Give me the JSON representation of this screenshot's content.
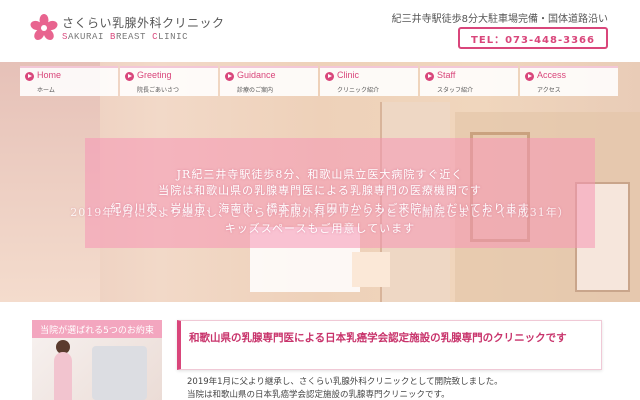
{
  "header": {
    "logo_jp": "さくらい乳腺外科クリニック",
    "logo_en_parts": [
      "S",
      "AKURAI ",
      "B",
      "REAST ",
      "C",
      "LINIC"
    ],
    "access_note": "紀三井寺駅徒歩8分大駐車場完備・国体道路沿い",
    "tel": "TEL：073-448-3366"
  },
  "nav": [
    {
      "en": "Home",
      "jp": "ホーム"
    },
    {
      "en": "Greeting",
      "jp": "院長ごあいさつ"
    },
    {
      "en": "Guidance",
      "jp": "診療のご案内"
    },
    {
      "en": "Clinic",
      "jp": "クリニック紹介"
    },
    {
      "en": "Staff",
      "jp": "スタッフ紹介"
    },
    {
      "en": "Access",
      "jp": "アクセス"
    }
  ],
  "hero": {
    "line1": "JR紀三井寺駅徒歩8分、和歌山県立医大病院すぐ近く",
    "line2": "当院は和歌山県の乳腺専門医による乳腺専門の医療機関です",
    "line3": "紀の川市、岩出市、海南市、橋本市、有田市からもご来院いただいております",
    "line4": "2019年1月に父より継承し、さくらい乳腺外科クリニックとして開院しました（平成31年）",
    "line5": "キッズスペースもご用意しています"
  },
  "promise": {
    "title": "当院が選ばれる5つのお約束"
  },
  "main": {
    "heading": "和歌山県の乳腺専門医による日本乳癌学会認定施設の乳腺専門のクリニックです",
    "body_line1": "2019年1月に父より継承し、さくらい乳腺外科クリニックとして開院致しました。",
    "body_line2": "当院は和歌山県の日本乳癌学会認定施設の乳腺専門クリニックです。"
  },
  "colors": {
    "brand_pink": "#d9467b",
    "hero_band": "#f696b4"
  }
}
